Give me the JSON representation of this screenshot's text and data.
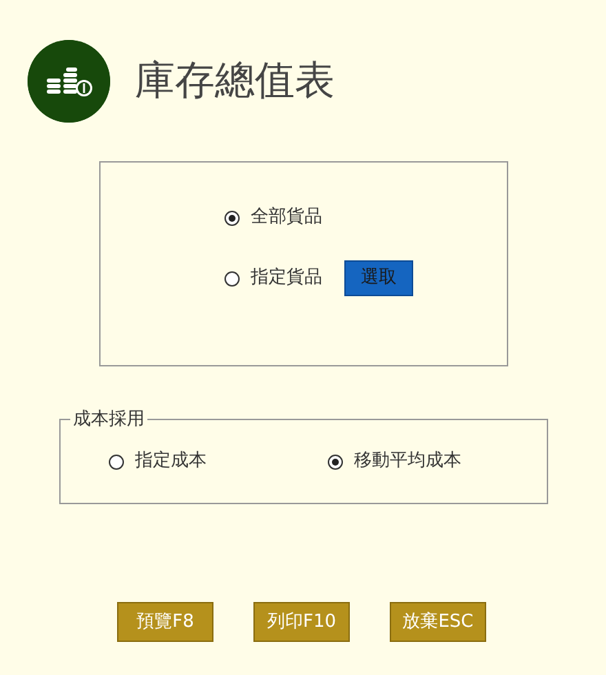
{
  "title": "庫存總值表",
  "goods_options": [
    {
      "label": "全部貨品",
      "selected": true
    },
    {
      "label": "指定貨品",
      "selected": false
    }
  ],
  "select_button": "選取",
  "cost_group": {
    "legend": "成本採用",
    "options": [
      {
        "label": "指定成本",
        "selected": false
      },
      {
        "label": "移動平均成本",
        "selected": true
      }
    ]
  },
  "buttons": [
    "預覽F8",
    "列印F10",
    "放棄ESC"
  ]
}
